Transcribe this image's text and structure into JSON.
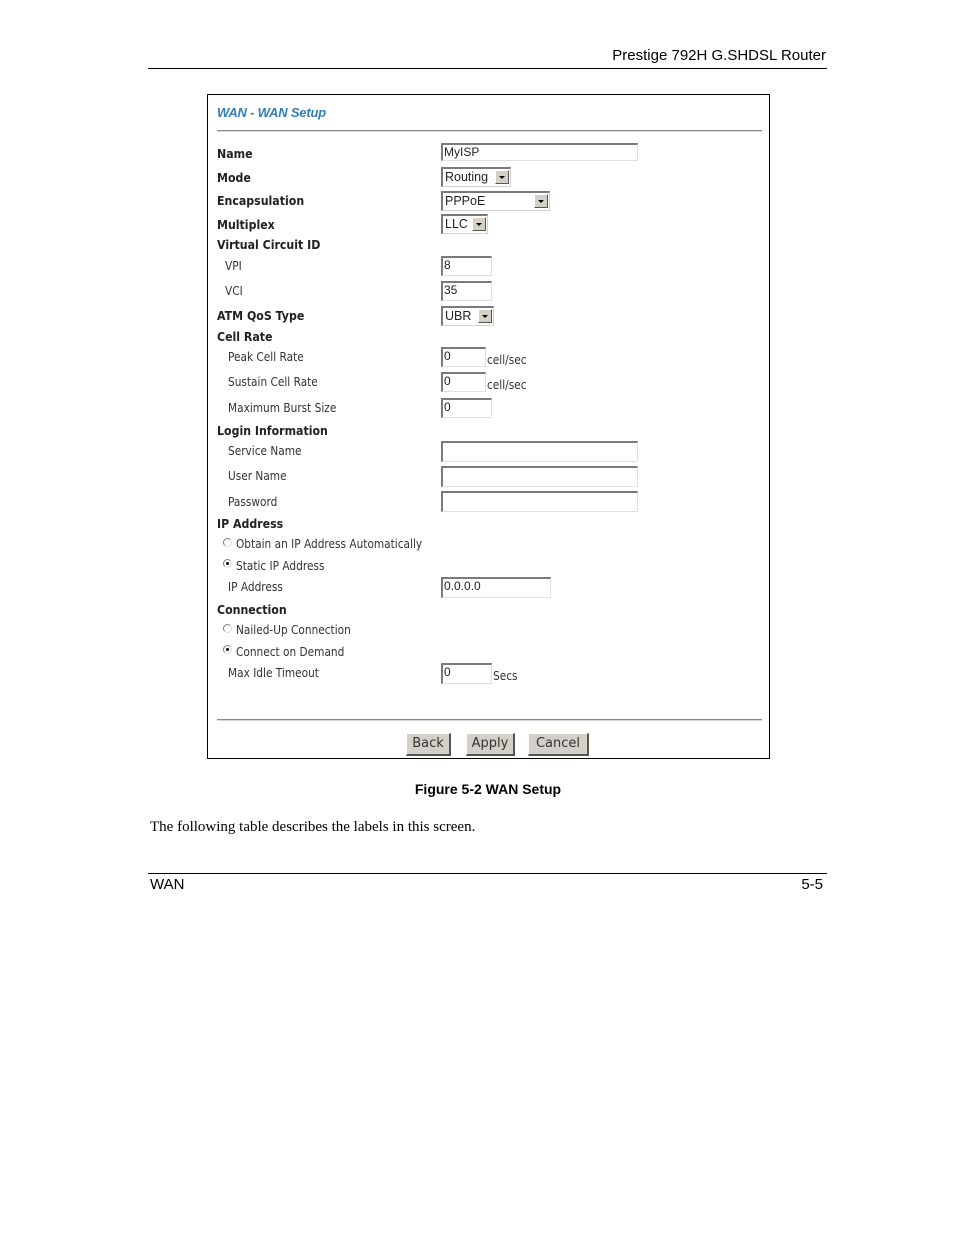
{
  "page": {
    "header_title": "Prestige 792H G.SHDSL Router",
    "figure_caption": "Figure 5-2 WAN Setup",
    "paragraph": "The following table describes the labels in this screen.",
    "footer_left": "WAN",
    "footer_right": "5-5"
  },
  "form": {
    "title": "WAN - WAN Setup",
    "name": {
      "label": "Name",
      "value": "MyISP"
    },
    "mode": {
      "label": "Mode",
      "value": "Routing"
    },
    "encapsulation": {
      "label": "Encapsulation",
      "value": "PPPoE"
    },
    "multiplex": {
      "label": "Multiplex",
      "value": "LLC"
    },
    "virtual_circuit": {
      "label": "Virtual Circuit ID",
      "vpi": {
        "label": "VPI",
        "value": "8"
      },
      "vci": {
        "label": "VCI",
        "value": "35"
      }
    },
    "atm_qos": {
      "label": "ATM QoS Type",
      "value": "UBR"
    },
    "cell_rate": {
      "label": "Cell Rate",
      "peak": {
        "label": "Peak Cell Rate",
        "value": "0",
        "unit": "cell/sec"
      },
      "sustain": {
        "label": "Sustain Cell Rate",
        "value": "0",
        "unit": "cell/sec"
      },
      "burst": {
        "label": "Maximum Burst Size",
        "value": "0"
      }
    },
    "login": {
      "label": "Login Information",
      "service_name": {
        "label": "Service Name",
        "value": ""
      },
      "user_name": {
        "label": "User Name",
        "value": ""
      },
      "password": {
        "label": "Password",
        "value": ""
      }
    },
    "ip_address": {
      "label": "IP Address",
      "auto": {
        "label": "Obtain an IP Address Automatically",
        "checked": false
      },
      "static": {
        "label": "Static IP Address",
        "checked": true
      },
      "address": {
        "label": "IP Address",
        "value": "0.0.0.0"
      }
    },
    "connection": {
      "label": "Connection",
      "nailed_up": {
        "label": "Nailed-Up Connection",
        "checked": false
      },
      "on_demand": {
        "label": "Connect on Demand",
        "checked": true
      },
      "idle_timeout": {
        "label": "Max Idle Timeout",
        "value": "0",
        "unit": "Secs"
      }
    },
    "buttons": {
      "back": "Back",
      "apply": "Apply",
      "cancel": "Cancel"
    }
  },
  "colors": {
    "title_accent": "#2f7fb5"
  }
}
